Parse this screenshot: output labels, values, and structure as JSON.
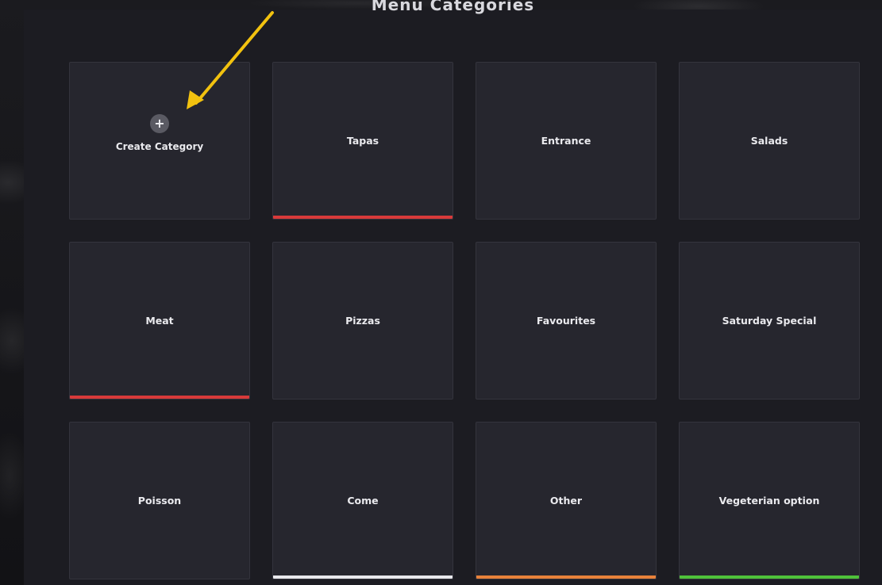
{
  "page": {
    "title": "Menu Categories"
  },
  "create_card": {
    "label": "Create Category",
    "icon": "plus-icon"
  },
  "categories": [
    {
      "label": "Tapas",
      "accent": "#d83a3a"
    },
    {
      "label": "Entrance",
      "accent": null
    },
    {
      "label": "Salads",
      "accent": null
    },
    {
      "label": "Meat",
      "accent": "#d83a3a"
    },
    {
      "label": "Pizzas",
      "accent": null
    },
    {
      "label": "Favourites",
      "accent": null
    },
    {
      "label": "Saturday Special",
      "accent": null
    },
    {
      "label": "Poisson",
      "accent": null
    },
    {
      "label": "Come",
      "accent": "#e8e8ec"
    },
    {
      "label": "Other",
      "accent": "#e8823a"
    },
    {
      "label": "Vegeterian option",
      "accent": "#4fc23a"
    }
  ],
  "annotation": {
    "icon": "arrow-annotation-icon",
    "color": "#f2c20f"
  },
  "colors": {
    "panel_bg": "#1c1c22",
    "card_bg": "#26262e",
    "card_border": "#34343d",
    "text": "#eaeaee"
  }
}
